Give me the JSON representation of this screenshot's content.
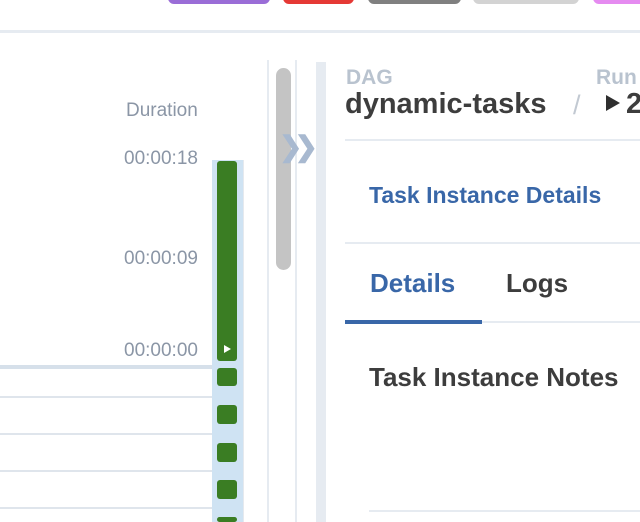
{
  "chips": [
    {
      "color": "#9a6dd7"
    },
    {
      "color": "#e53935"
    },
    {
      "color": "#808080"
    },
    {
      "color": "#d3d3d3"
    },
    {
      "color": "#e58bf0"
    }
  ],
  "grid": {
    "duration_label": "Duration",
    "ticks": [
      "00:00:18",
      "00:00:09",
      "00:00:00"
    ],
    "bar_color": "#3a7d23",
    "column_highlight": "#cfe3f3"
  },
  "toggle": {
    "icon": "double-chevron-right-icon",
    "glyph": "❯❯"
  },
  "header": {
    "dag_label": "DAG",
    "dag_id": "dynamic-tasks",
    "separator": "/",
    "run_label": "Run",
    "run_value": "2"
  },
  "panel": {
    "link": "Task Instance Details",
    "tabs": [
      {
        "label": "Details",
        "active": true
      },
      {
        "label": "Logs",
        "active": false
      }
    ],
    "section_title": "Task Instance Notes"
  },
  "colors": {
    "accent": "#3967a8",
    "text": "#3d3d3d",
    "muted": "#8b96a6"
  }
}
